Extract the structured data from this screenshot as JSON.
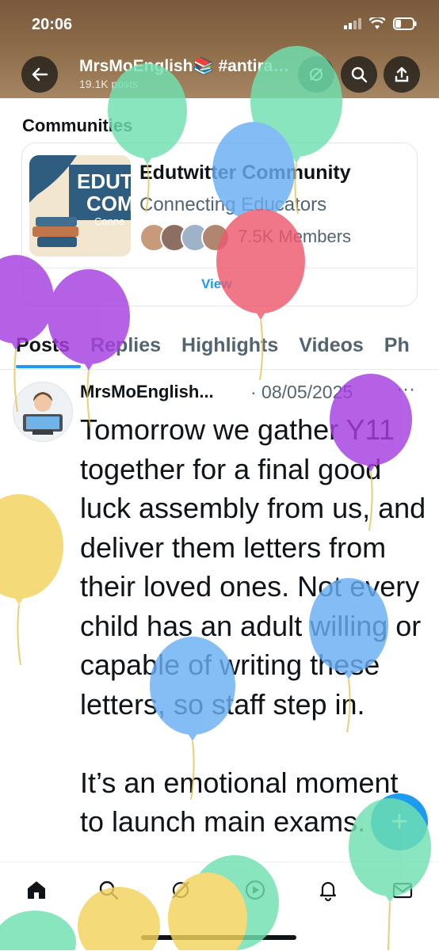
{
  "status": {
    "time": "20:06"
  },
  "header": {
    "title": "MrsMoEnglish📚 #antira…",
    "subtitle": "19.1K posts"
  },
  "communities": {
    "heading": "Communities",
    "card": {
      "name": "Edutwitter Community",
      "description": "Connecting Educators",
      "members": "7.5K Members",
      "thumb_text_1": "EDUT",
      "thumb_text_2": "COM",
      "thumb_text_3": "Conne"
    },
    "view_label": "View"
  },
  "tabs": [
    "Posts",
    "Replies",
    "Highlights",
    "Videos",
    "Ph"
  ],
  "tweet": {
    "author": "MrsMoEnglish...",
    "date": "· 08/05/2025",
    "more": "···",
    "text": "Tomorrow we gather Y11 together for a final good luck assembly from us, and deliver them letters from their loved ones. Not every child has an adult willing or capable of writing these letters, so staff step in.\n\nIt’s an emotional moment to launch main exams."
  },
  "fab": {
    "label": "+"
  },
  "colors": {
    "accent": "#1d9bf0",
    "balloon_green": "#6fe0b0",
    "balloon_blue": "#6aaef3",
    "balloon_red": "#ec5a6e",
    "balloon_purple": "#a63fe0",
    "balloon_yellow": "#f2d35c"
  },
  "icons": {
    "back": "arrow-left-icon",
    "search": "search-icon",
    "share": "share-icon",
    "nav": [
      "home-icon",
      "search-icon",
      "grok-icon",
      "play-icon",
      "bell-icon",
      "mail-icon"
    ]
  }
}
